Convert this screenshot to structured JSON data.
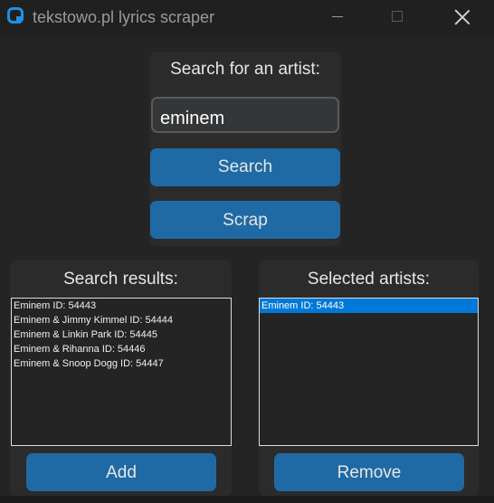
{
  "window": {
    "title": "tekstowo.pl lyrics scraper",
    "icon": "app-icon",
    "controls": [
      "minimize-icon",
      "maximize-icon",
      "close-icon"
    ]
  },
  "search_panel": {
    "label": "Search for an artist:",
    "input_value": "eminem",
    "search_button": "Search",
    "scrap_button": "Scrap"
  },
  "results_panel": {
    "label": "Search results:",
    "items": [
      "Eminem ID: 54443",
      "Eminem & Jimmy Kimmel ID: 54444",
      "Eminem & Linkin Park ID: 54445",
      "Eminem & Rihanna ID: 54446",
      "Eminem & Snoop Dogg ID: 54447"
    ],
    "add_button": "Add"
  },
  "selected_panel": {
    "label": "Selected artists:",
    "items": [
      "Eminem ID: 54443"
    ],
    "selected_index": 0,
    "remove_button": "Remove"
  },
  "colors": {
    "accent": "#1f6aa5",
    "selection": "#0078d7",
    "background": "#242424",
    "frame": "#2b2b2b",
    "app_icon": "#1e90e6"
  }
}
